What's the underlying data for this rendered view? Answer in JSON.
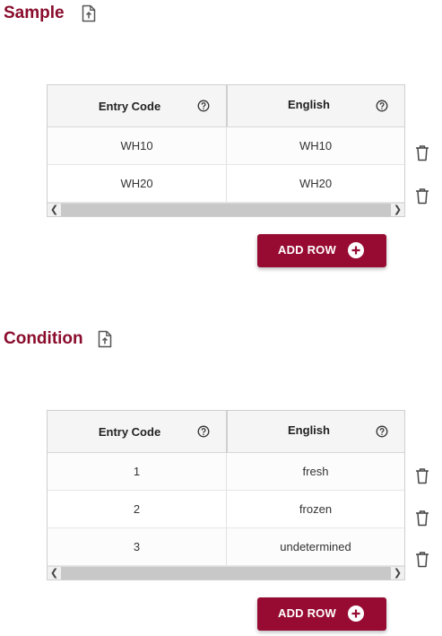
{
  "sections": [
    {
      "title": "Sample",
      "columns": [
        "Entry Code",
        "English"
      ],
      "rows": [
        [
          "WH10",
          "WH10"
        ],
        [
          "WH20",
          "WH20"
        ]
      ],
      "add_row_label": "ADD ROW"
    },
    {
      "title": "Condition",
      "columns": [
        "Entry Code",
        "English"
      ],
      "rows": [
        [
          "1",
          "fresh"
        ],
        [
          "2",
          "frozen"
        ],
        [
          "3",
          "undetermined"
        ]
      ],
      "add_row_label": "ADD ROW"
    }
  ],
  "icons": {
    "upload": "file-upload-icon",
    "help": "help-circle-icon",
    "delete": "trash-icon",
    "add": "plus-circle-icon",
    "scroll_left": "chevron-left-icon",
    "scroll_right": "chevron-right-icon"
  },
  "colors": {
    "brand": "#8a0c2c",
    "button": "#970b32",
    "header_bg": "#f5f5f5",
    "scrollbar": "#c8c8c8"
  }
}
